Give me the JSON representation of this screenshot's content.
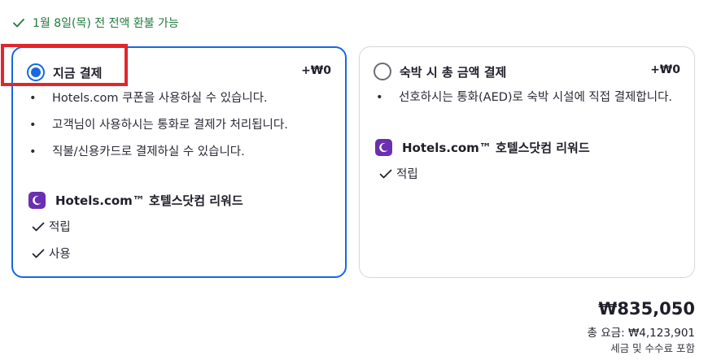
{
  "refund_notice": {
    "icon": "checkmark-icon",
    "text": "1월 8일(목) 전 전액 환불 가능",
    "color": "#1f7a3a"
  },
  "options": {
    "pay_now": {
      "title": "지금 결제",
      "price": "+₩0",
      "selected": true,
      "bullets": [
        "Hotels.com 쿠폰을 사용하실 수 있습니다.",
        "고객님이 사용하시는 통화로 결제가 처리됩니다.",
        "직불/신용카드로 결제하실 수 있습니다."
      ],
      "rewards_label": "Hotels.com™ 호텔스닷컴 리워드",
      "checks": [
        "적립",
        "사용"
      ]
    },
    "pay_at_property": {
      "title": "숙박 시 총 금액 결제",
      "price": "+₩0",
      "selected": false,
      "bullets": [
        "선호하시는 통화(AED)로 숙박 시설에 직접 결제합니다."
      ],
      "rewards_label": "Hotels.com™ 호텔스닷컴 리워드",
      "checks": [
        "적립"
      ]
    }
  },
  "summary": {
    "price": "₩835,050",
    "total": "총 요금: ₩4,123,901",
    "tax_note": "세금 및 수수료 포함"
  },
  "colors": {
    "accent": "#1668e3",
    "highlight": "#e3252c",
    "rewards_brand": "#6b2fb1"
  }
}
